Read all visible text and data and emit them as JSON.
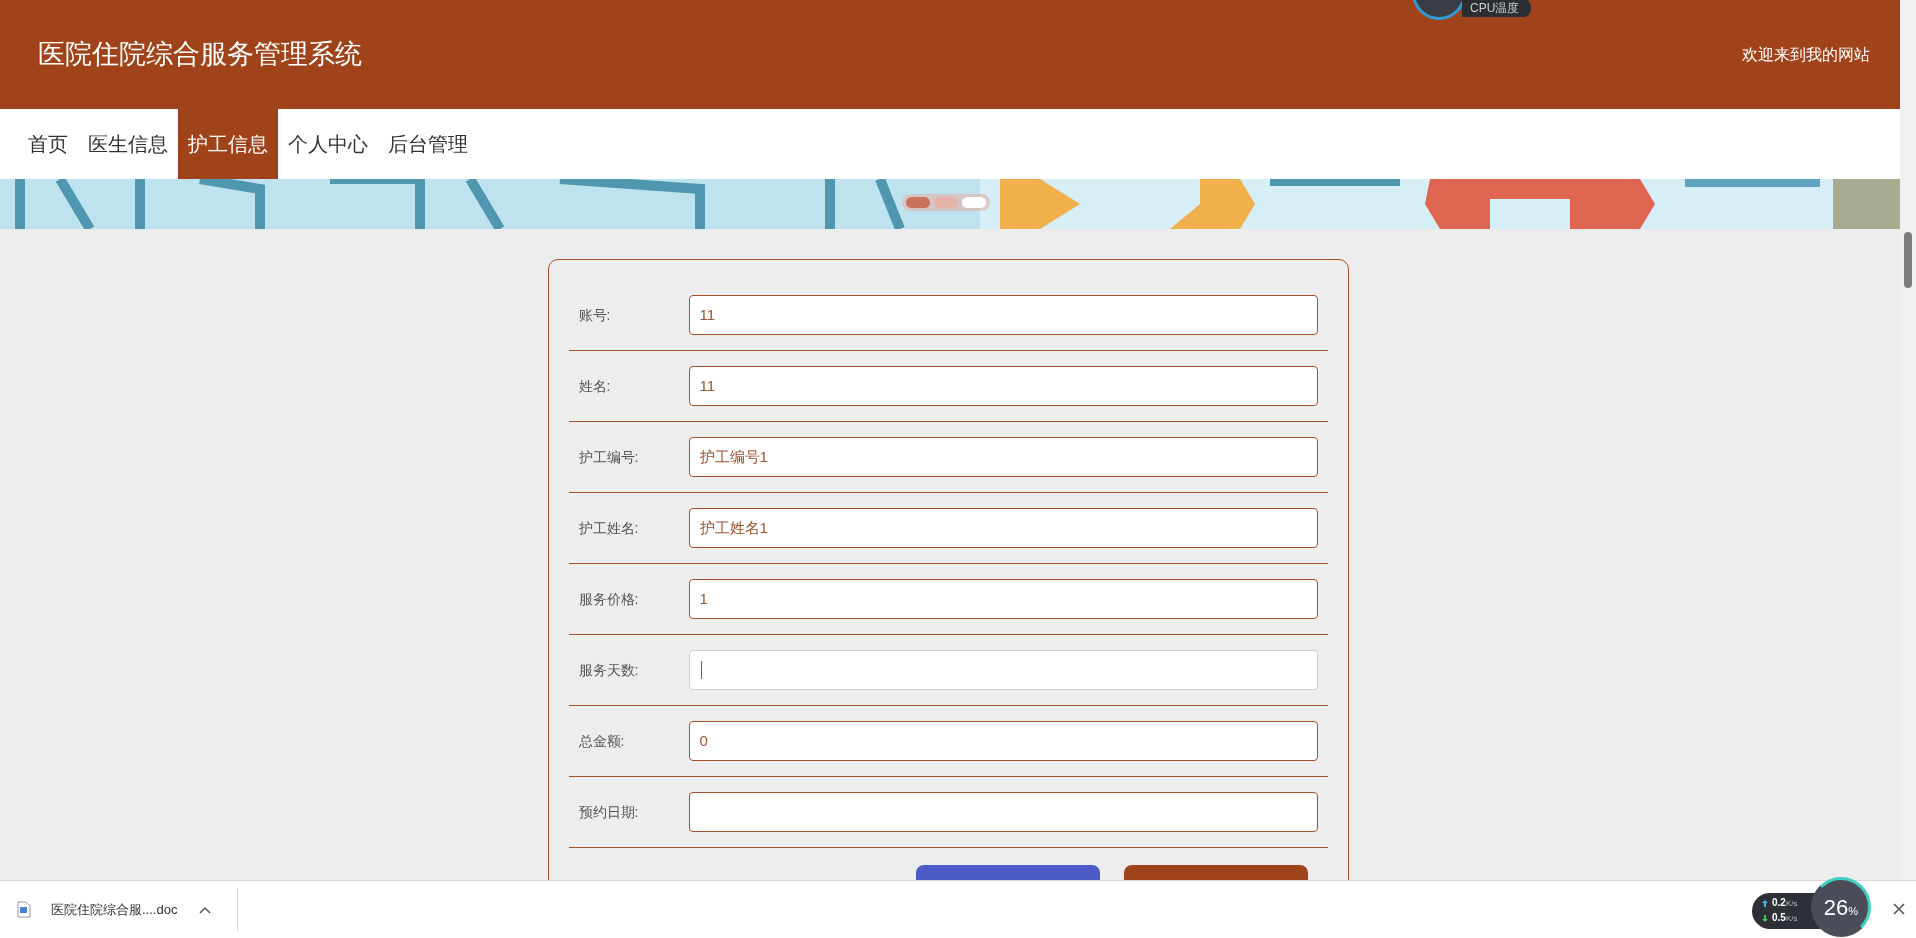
{
  "header": {
    "title": "医院住院综合服务管理系统",
    "welcome": "欢迎来到我的网站"
  },
  "nav": [
    {
      "label": "首页",
      "selected": false
    },
    {
      "label": "医生信息",
      "selected": false
    },
    {
      "label": "护工信息",
      "selected": true
    },
    {
      "label": "个人中心",
      "selected": false
    },
    {
      "label": "后台管理",
      "selected": false
    }
  ],
  "banner": {
    "dots": [
      {
        "selected": true
      },
      {
        "selected": false
      },
      {
        "selected": false
      }
    ]
  },
  "form": {
    "fields": [
      {
        "label": "账号:",
        "value": "11",
        "focused": false
      },
      {
        "label": "姓名:",
        "value": "11",
        "focused": false
      },
      {
        "label": "护工编号:",
        "value": "护工编号1",
        "focused": false
      },
      {
        "label": "护工姓名:",
        "value": "护工姓名1",
        "focused": false
      },
      {
        "label": "服务价格:",
        "value": "1",
        "focused": false
      },
      {
        "label": "服务天数:",
        "focused": true
      },
      {
        "label": "总金额:",
        "value": "0",
        "focused": false
      },
      {
        "label": "预约日期:",
        "focused": false
      }
    ],
    "buttons": [
      {
        "kind": "primary"
      },
      {
        "kind": "secondary"
      }
    ]
  },
  "cpu_widget": {
    "label": "CPU温度"
  },
  "download_bar": {
    "file": "医院住院综合服....doc"
  },
  "net_widget": {
    "upload": "0.2",
    "download": "0.5",
    "unit_up": "K/s",
    "unit_down": "K/s",
    "percent": "26",
    "percent_sign": "%"
  }
}
